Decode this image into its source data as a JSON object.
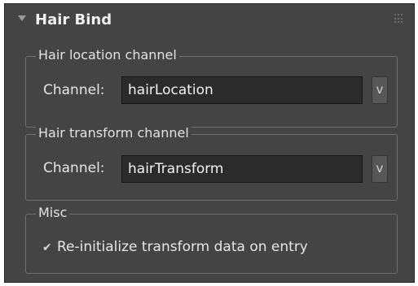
{
  "rollout": {
    "title": "Hair Bind"
  },
  "location_group": {
    "title": "Hair location channel",
    "channel_label": "Channel:",
    "channel_value": "hairLocation",
    "dropdown_label": "v"
  },
  "transform_group": {
    "title": "Hair transform channel",
    "channel_label": "Channel:",
    "channel_value": "hairTransform",
    "dropdown_label": "v"
  },
  "misc_group": {
    "title": "Misc",
    "checkbox_label": "Re-initialize transform data on entry",
    "checkbox_checked": true,
    "checkbox_glyph": "✔"
  },
  "colors": {
    "panel_bg": "#444444",
    "input_bg": "#2b2b2b",
    "text": "#e6e6e6"
  }
}
